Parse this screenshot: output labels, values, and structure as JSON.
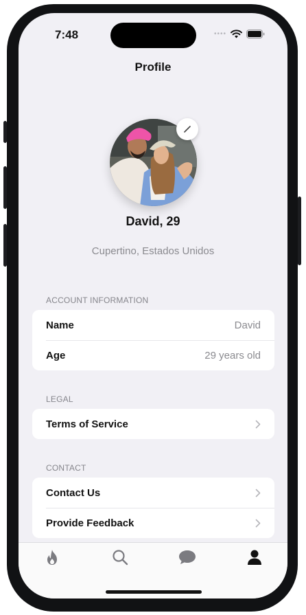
{
  "status": {
    "time": "7:48"
  },
  "header": {
    "title": "Profile"
  },
  "profile": {
    "name": "David, 29",
    "location": "Cupertino, Estados Unidos"
  },
  "sections": {
    "account": {
      "title": "ACCOUNT INFORMATION",
      "rows": [
        {
          "label": "Name",
          "value": "David"
        },
        {
          "label": "Age",
          "value": "29 years old"
        }
      ]
    },
    "legal": {
      "title": "LEGAL",
      "rows": [
        {
          "label": "Terms of Service"
        }
      ]
    },
    "contact": {
      "title": "CONTACT",
      "rows": [
        {
          "label": "Contact Us"
        },
        {
          "label": "Provide Feedback"
        }
      ]
    }
  },
  "tabs": [
    {
      "icon": "flame-icon",
      "active": false
    },
    {
      "icon": "search-icon",
      "active": false
    },
    {
      "icon": "chat-bubble-icon",
      "active": false
    },
    {
      "icon": "person-icon",
      "active": true
    }
  ],
  "colors": {
    "background": "#f1f0f5",
    "card": "#ffffff",
    "text": "#111111",
    "secondary": "#8a8a8f",
    "inactive_tab": "#7b7b80"
  }
}
